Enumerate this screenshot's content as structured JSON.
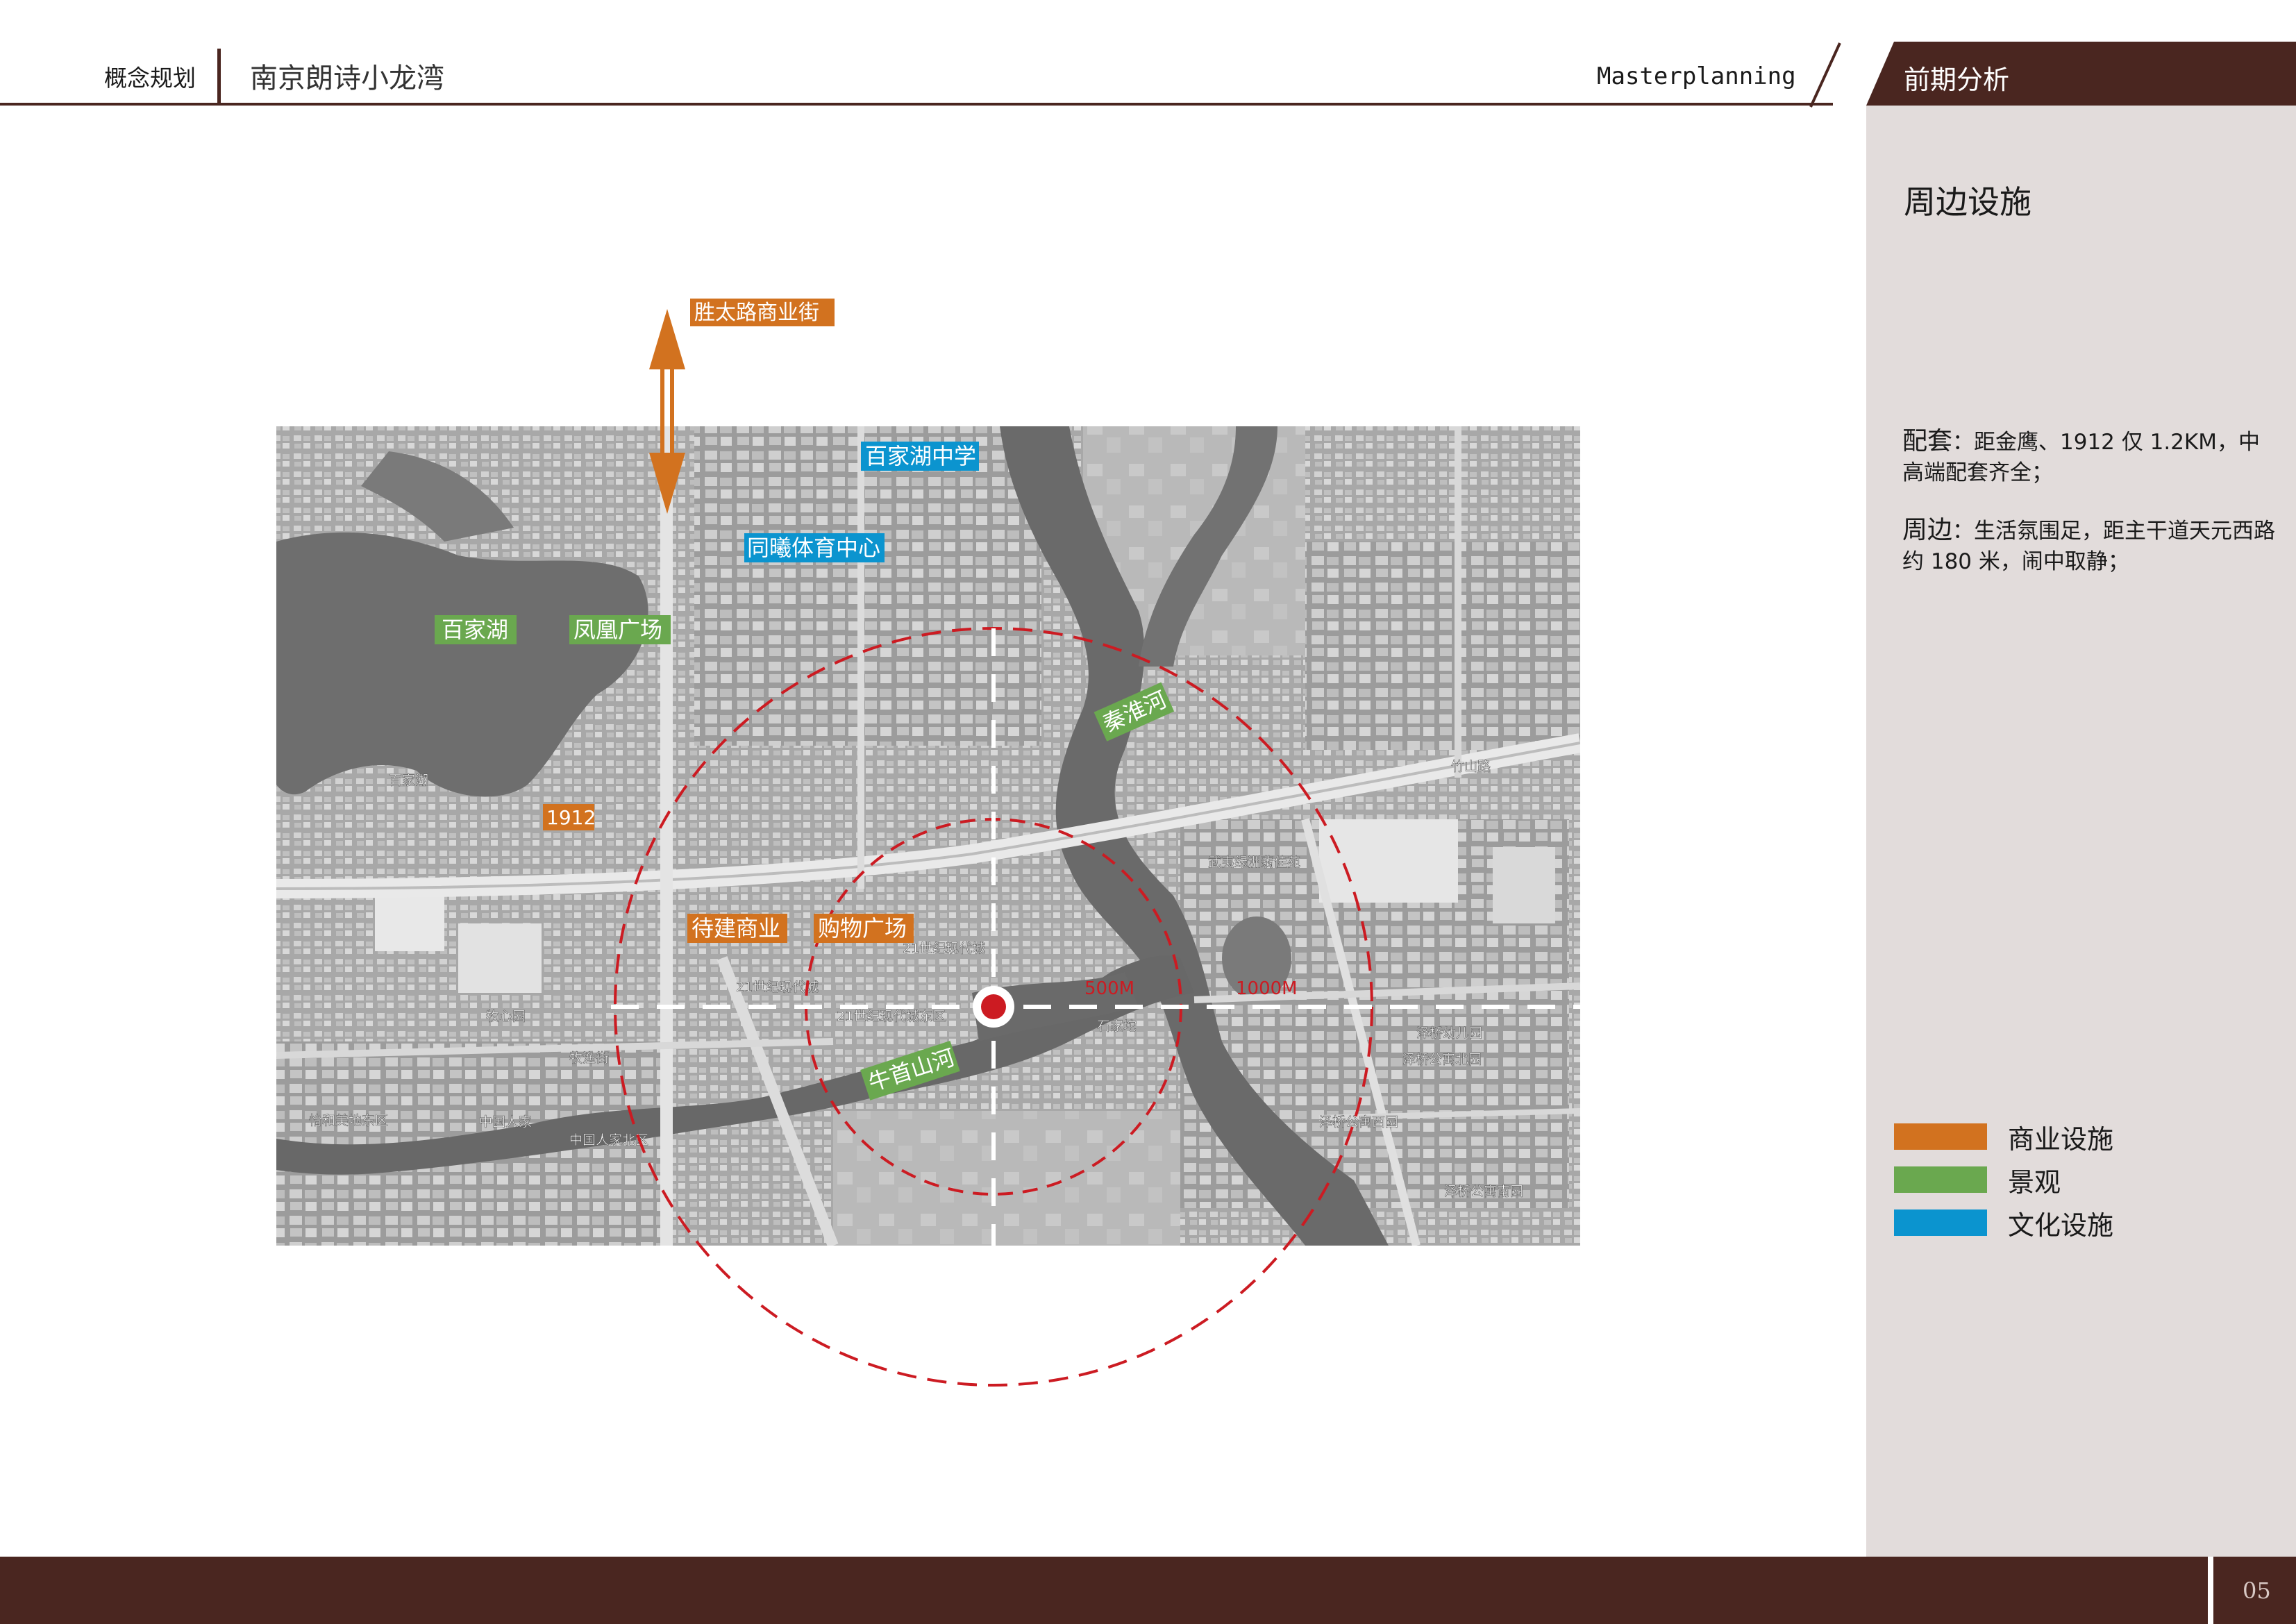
{
  "header": {
    "category": "概念规划",
    "project": "南京朗诗小龙湾",
    "english": "Masterplanning",
    "section": "前期分析"
  },
  "panel": {
    "title": "周边设施",
    "items": [
      {
        "label": "配套",
        "text": "：距金鹰、1912 仅 1.2KM，中高端配套齐全；"
      },
      {
        "label": "周边",
        "text": "：生活氛围足，距主干道天元西路约 180 米，闹中取静；"
      }
    ],
    "legend": [
      {
        "color": "#d2721f",
        "label": "商业设施"
      },
      {
        "color": "#6aa84f",
        "label": "景观"
      },
      {
        "color": "#0b94cf",
        "label": "文化设施"
      }
    ]
  },
  "map": {
    "labels": {
      "north_road": "胜太路商业街",
      "school": "百家湖中学",
      "sports": "同曦体育中心",
      "lake": "百家湖",
      "square": "凤凰广场",
      "qinhuai": "秦淮河",
      "s1912": "1912",
      "pending": "待建商业",
      "mall": "购物广场",
      "niushou": "牛首山河",
      "r500": "500M",
      "r1000": "1000M"
    },
    "base_labels": [
      "竹山路",
      "武夷绿洲翡佳苑",
      "21世纪现代城",
      "21世纪现代城东区",
      "21世纪现代城",
      "百家湖",
      "牧心园",
      "怡和美地东区",
      "中国人家",
      "中国人家北区",
      "泽桥公寓北园",
      "泽桥公寓西园",
      "泽桥公寓南园",
      "泽桥幼儿园",
      "石家坨",
      "牧渔街"
    ],
    "colors": {
      "commercial": "#d2721f",
      "landscape": "#6aa84f",
      "culture": "#0b94cf",
      "rings": "#cc1b22"
    }
  },
  "footer": {
    "page": "05"
  }
}
